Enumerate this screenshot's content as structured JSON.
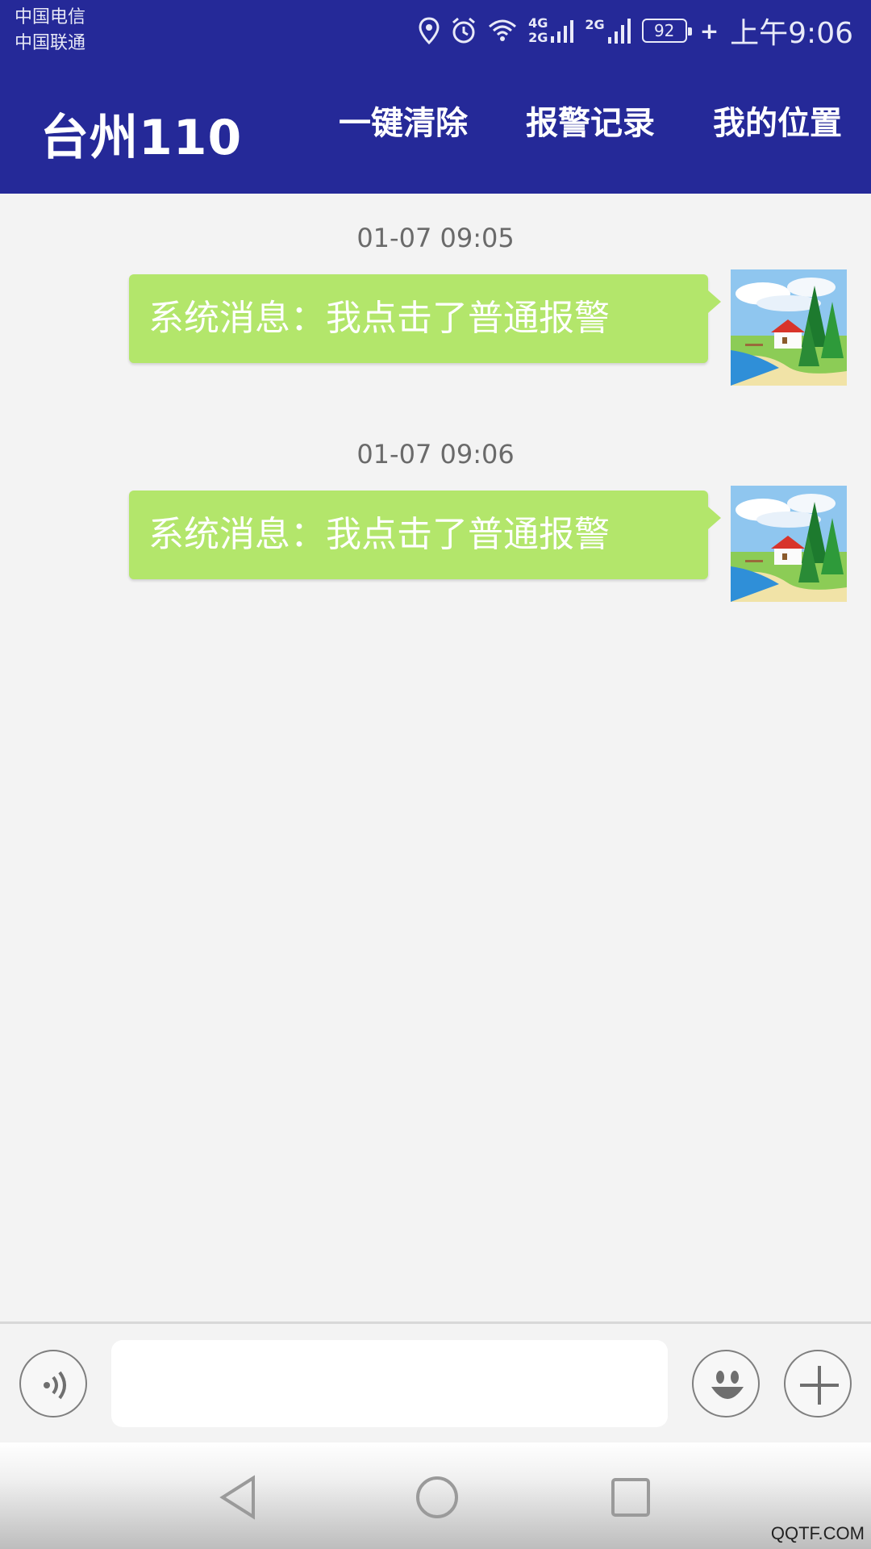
{
  "status_bar": {
    "carrier_1": "中国电信",
    "carrier_2": "中国联通",
    "net_top": "4G",
    "net_bottom": "2G",
    "net_2": "2G",
    "battery": "92",
    "time": "上午9:06",
    "icons": [
      "location-icon",
      "alarm-icon",
      "wifi-icon",
      "signal-icon",
      "signal-icon",
      "battery-icon",
      "charging-icon"
    ]
  },
  "app_bar": {
    "title": "台州110",
    "actions": [
      "一键清除",
      "报警记录",
      "我的位置"
    ]
  },
  "messages": [
    {
      "time": "01-07 09:05",
      "text": "系统消息：我点击了普通报警"
    },
    {
      "time": "01-07 09:06",
      "text": "系统消息：我点击了普通报警"
    }
  ],
  "input_bar": {
    "value": "",
    "icons": [
      "voice-icon",
      "emoji-icon",
      "plus-icon"
    ]
  },
  "nav_bar": {
    "icons": [
      "back-icon",
      "home-icon",
      "recents-icon"
    ]
  },
  "watermark": "QQTF.COM",
  "colors": {
    "app_bar": "#252998",
    "bubble": "#b3e66b",
    "background": "#f3f3f3"
  }
}
